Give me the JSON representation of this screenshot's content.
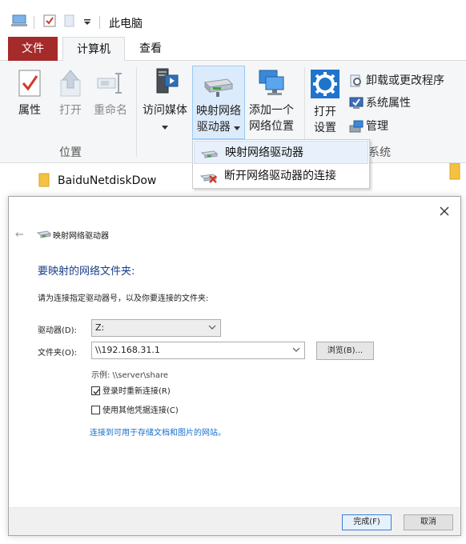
{
  "window": {
    "title": "此电脑"
  },
  "tabs": [
    {
      "label": "文件"
    },
    {
      "label": "计算机"
    },
    {
      "label": "查看"
    }
  ],
  "ribbon": {
    "location_group": {
      "label": "位置",
      "properties": "属性",
      "open": "打开",
      "rename": "重命名"
    },
    "network_group": {
      "access_media": "访问媒体",
      "map_drive_line1": "映射网络",
      "map_drive_line2": "驱动器",
      "add_location_line1": "添加一个",
      "add_location_line2": "网络位置"
    },
    "system_group": {
      "label": "系统",
      "open_settings_line1": "打开",
      "open_settings_line2": "设置",
      "uninstall": "卸载或更改程序",
      "system_properties": "系统属性",
      "manage": "管理"
    }
  },
  "dropdown": {
    "items": [
      {
        "label": "映射网络驱动器"
      },
      {
        "label": "断开网络驱动器的连接"
      }
    ]
  },
  "folder_row": {
    "name": "BaiduNetdiskDow"
  },
  "dialog": {
    "title": "映射网络驱动器",
    "heading": "要映射的网络文件夹:",
    "instruction": "请为连接指定驱动器号，以及你要连接的文件夹:",
    "drive_label": "驱动器(D):",
    "drive_value": "Z:",
    "folder_label": "文件夹(O):",
    "folder_value": "\\\\192.168.31.1",
    "browse_button": "浏览(B)...",
    "example": "示例: \\\\server\\share",
    "reconnect_label": "登录时重新连接(R)",
    "reconnect_checked": true,
    "other_credentials_label": "使用其他凭据连接(C)",
    "other_credentials_checked": false,
    "link_text": "连接到可用于存储文档和图片的网站。",
    "finish_button": "完成(F)",
    "cancel_button": "取消"
  },
  "colors": {
    "file_tab": "#a52a2a",
    "heading": "#1a3e8a",
    "link": "#1a6fc9",
    "highlight": "#dcebfc"
  }
}
